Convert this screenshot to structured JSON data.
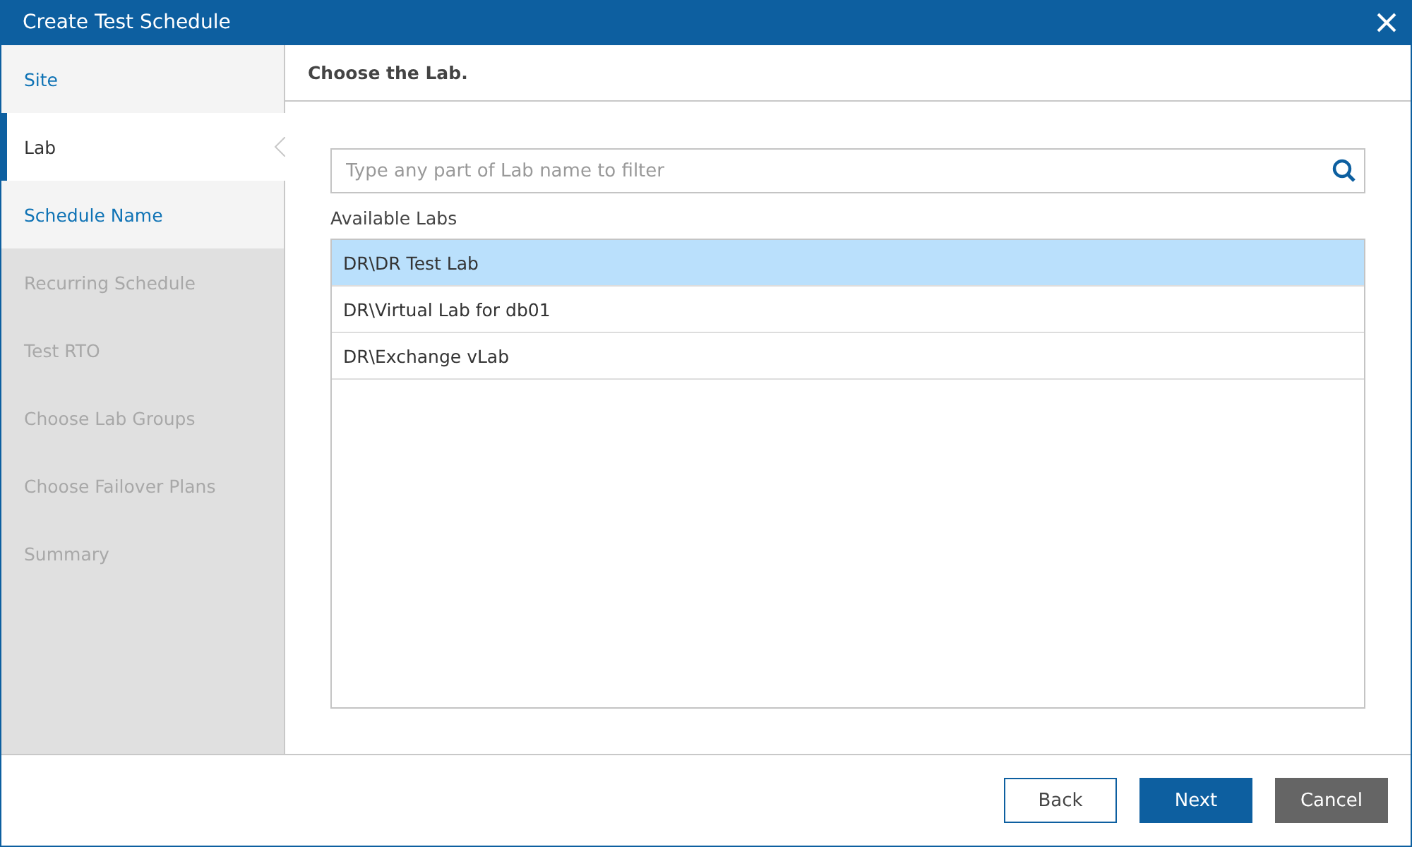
{
  "window": {
    "title": "Create Test Schedule"
  },
  "steps": [
    {
      "label": "Site",
      "selected": false,
      "disabled": false
    },
    {
      "label": "Lab",
      "selected": true,
      "disabled": false
    },
    {
      "label": "Schedule Name",
      "selected": false,
      "disabled": false
    },
    {
      "label": "Recurring Schedule",
      "selected": false,
      "disabled": true
    },
    {
      "label": "Test RTO",
      "selected": false,
      "disabled": true
    },
    {
      "label": "Choose Lab Groups",
      "selected": false,
      "disabled": true
    },
    {
      "label": "Choose Failover Plans",
      "selected": false,
      "disabled": true
    },
    {
      "label": "Summary",
      "selected": false,
      "disabled": true
    }
  ],
  "page_heading": "Choose the Lab.",
  "search": {
    "placeholder": "Type any part of Lab name to filter"
  },
  "list_label": "Available Labs",
  "labs": [
    {
      "name": "DR\\DR Test Lab",
      "selected": true
    },
    {
      "name": "DR\\Virtual Lab for db01",
      "selected": false
    },
    {
      "name": "DR\\Exchange vLab",
      "selected": false
    }
  ],
  "buttons": [
    {
      "label": "Back",
      "kind": "outline"
    },
    {
      "label": "Next",
      "kind": "primary"
    },
    {
      "label": "Cancel",
      "kind": "secondary"
    }
  ]
}
